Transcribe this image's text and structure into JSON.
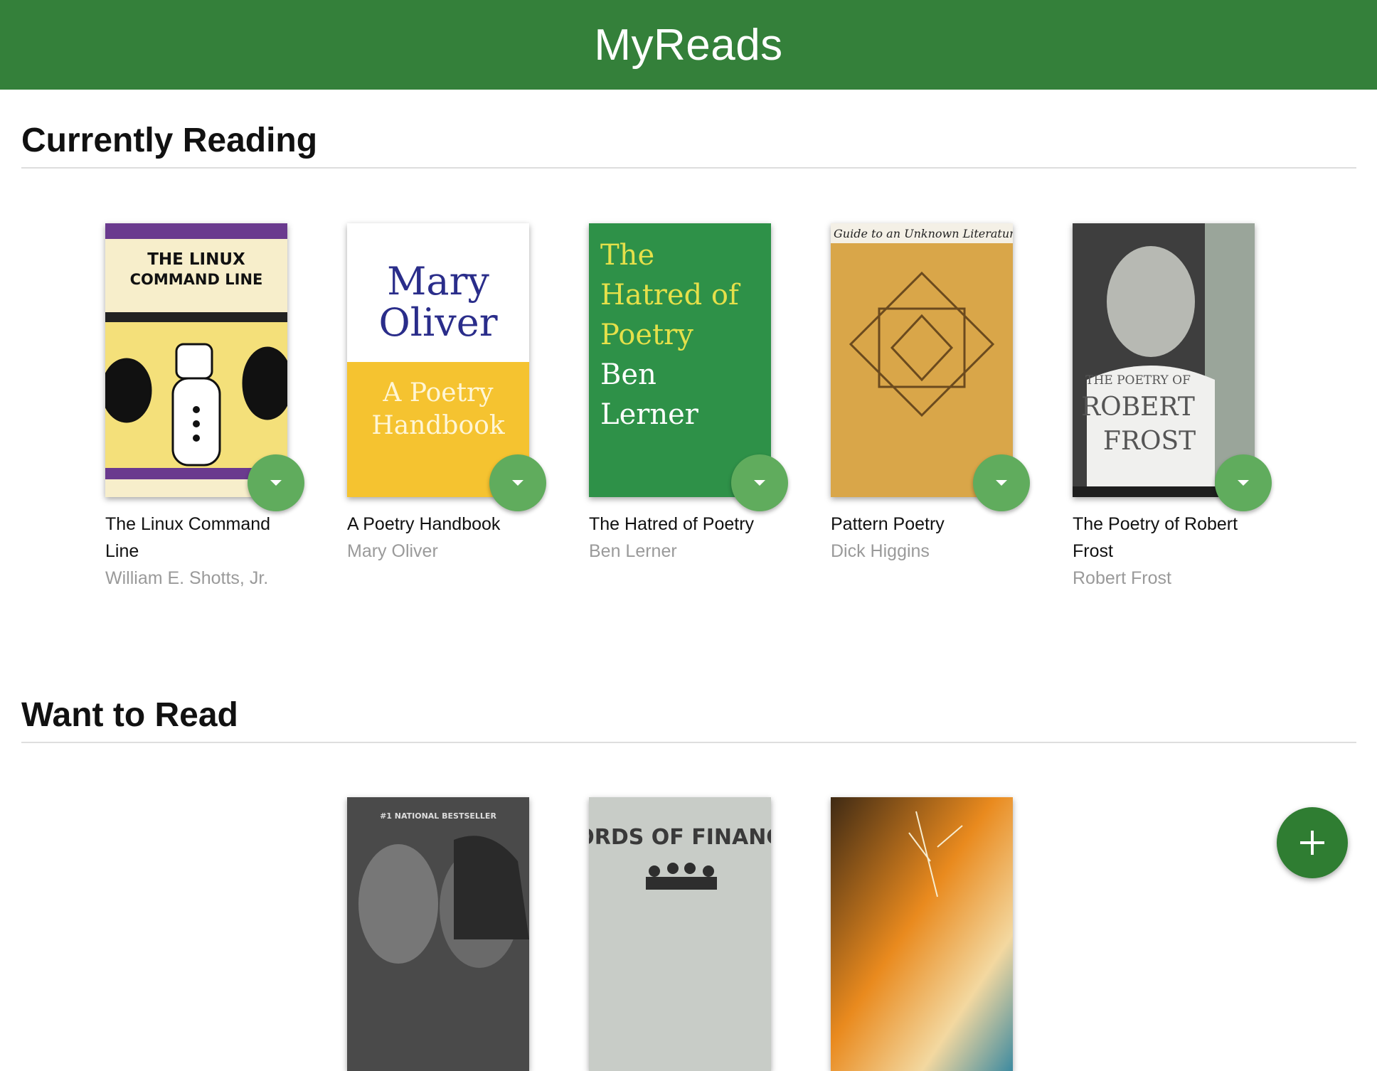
{
  "header": {
    "title": "MyReads"
  },
  "shelves": [
    {
      "title": "Currently Reading",
      "books": [
        {
          "title": "The Linux Command Line",
          "author": "William E. Shotts, Jr.",
          "cover": {
            "line1": "THE LINUX",
            "line2": "COMMAND LINE"
          }
        },
        {
          "title": "A Poetry Handbook",
          "author": "Mary Oliver",
          "cover": {
            "line1": "Mary",
            "line2": "Oliver",
            "line3": "A Poetry",
            "line4": "Handbook"
          }
        },
        {
          "title": "The Hatred of Poetry",
          "author": "Ben Lerner",
          "cover": {
            "line1": "The",
            "line2": "Hatred of",
            "line3": "Poetry",
            "line4": "Ben",
            "line5": "Lerner"
          }
        },
        {
          "title": "Pattern Poetry",
          "author": "Dick Higgins",
          "cover": {
            "line1": "Guide to an Unknown Literature"
          }
        },
        {
          "title": "The Poetry of Robert Frost",
          "author": "Robert Frost",
          "cover": {
            "line1": "THE POETRY OF",
            "line2": "ROBERT",
            "line3": "FROST"
          }
        }
      ]
    },
    {
      "title": "Want to Read",
      "books": [
        {
          "cover": {
            "line1": "#1 NATIONAL BESTSELLER"
          }
        },
        {
          "cover": {
            "line1": "LORDS OF FINANCE"
          }
        },
        {
          "cover": {}
        }
      ]
    }
  ],
  "colors": {
    "header": "#34803a",
    "shelf_changer": "#60ac5d",
    "add_button": "#2f7d32"
  },
  "icons": {
    "shelf_changer": "caret-down-icon",
    "add": "plus-icon"
  }
}
